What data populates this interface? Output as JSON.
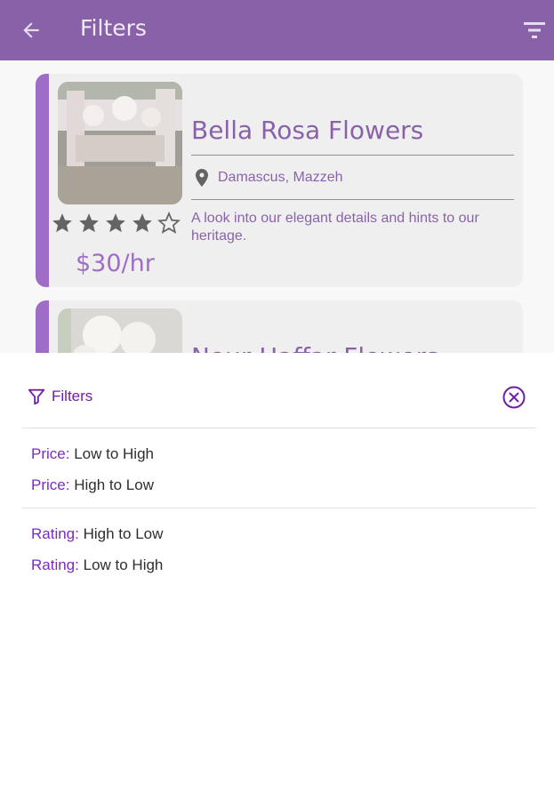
{
  "appbar": {
    "title": "Filters",
    "back_icon": "arrow-left-icon",
    "sort_icon": "filter-list-icon"
  },
  "cards": [
    {
      "title": "Bella Rosa Flowers",
      "location": "Damascus, Mazzeh",
      "description": "A look into our elegant details and hints to our heritage.",
      "rating": 4,
      "rating_max": 5,
      "price": "$30/hr"
    },
    {
      "title": "Nour Haffar Flowers",
      "location": "",
      "description": ""
    }
  ],
  "sheet": {
    "title": "Filters",
    "filter_icon": "funnel-icon",
    "close_icon": "close-circle-icon",
    "price_group": [
      {
        "key": "Price:",
        "value": "Low to High"
      },
      {
        "key": "Price:",
        "value": "High to Low"
      }
    ],
    "rating_group": [
      {
        "key": "Rating:",
        "value": "High to Low"
      },
      {
        "key": "Rating:",
        "value": "Low to High"
      }
    ]
  },
  "colors": {
    "appbar": "#4a0d7a",
    "accent": "#6e1fa8",
    "option_key": "#7b2cbf"
  }
}
